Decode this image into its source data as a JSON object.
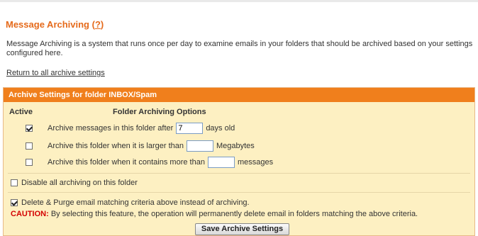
{
  "page": {
    "title": "Message Archiving",
    "help_link": "?",
    "description": "Message Archiving is a system that runs once per day to examine emails in your folders that should be archived based on your settings configured here.",
    "return_link": "Return to all archive settings"
  },
  "panel": {
    "header": "Archive Settings for folder INBOX/Spam",
    "col_active": "Active",
    "col_options": "Folder Archiving Options",
    "rule_after": {
      "checked": true,
      "prefix": "Archive messages in this folder after",
      "value": "7",
      "suffix": "days old"
    },
    "rule_size": {
      "checked": false,
      "prefix": "Archive this folder when it is larger than",
      "value": "",
      "suffix": "Megabytes"
    },
    "rule_count": {
      "checked": false,
      "prefix": "Archive this folder when it contains more than",
      "value": "",
      "suffix": "messages"
    },
    "disable": {
      "checked": false,
      "label": "Disable all archiving on this folder"
    },
    "purge": {
      "checked": true,
      "label": "Delete & Purge email matching criteria above instead of archiving."
    },
    "caution_label": "CAUTION:",
    "caution_text": " By selecting this feature, the operation will permanently delete email in folders matching the above criteria.",
    "save_button": "Save Archive Settings"
  },
  "colors": {
    "accent": "#e56a1b",
    "header_bg": "#f07f1c",
    "panel_bg": "#fdf0c2",
    "caution": "#d40000"
  }
}
